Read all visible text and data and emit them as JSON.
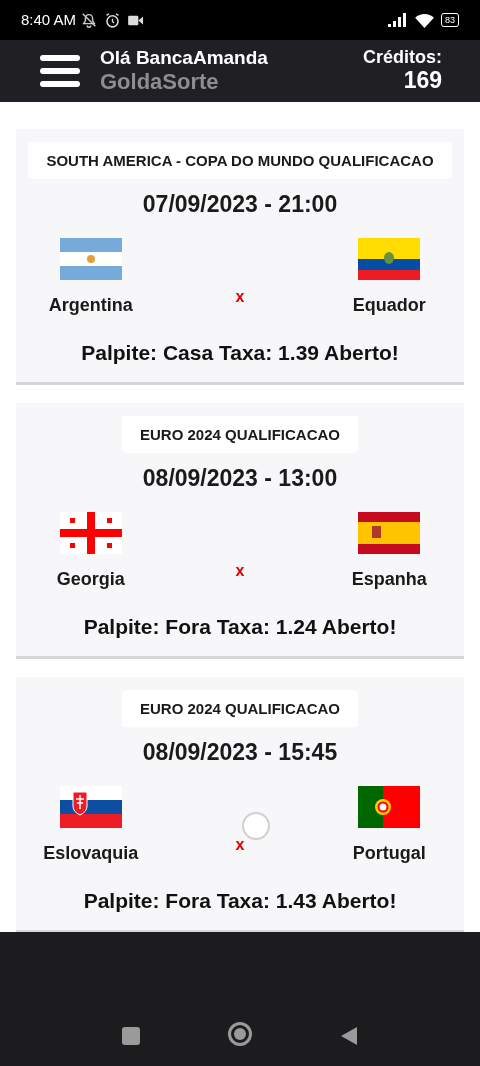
{
  "status_bar": {
    "time": "8:40 AM",
    "battery": "83"
  },
  "app_bar": {
    "greeting": "Olá BancaAmanda",
    "app_name": "GoldaSorte",
    "credits_label": "Créditos:",
    "credits_value": "169"
  },
  "matches": [
    {
      "league": "SOUTH AMERICA - COPA DO MUNDO QUALIFICACAO",
      "datetime": "07/09/2023 - 21:00",
      "home": {
        "name": "Argentina",
        "kind": "ar"
      },
      "separator": "x",
      "away": {
        "name": "Equador",
        "kind": "ec"
      },
      "tip": "Palpite: Casa Taxa: 1.39 Aberto!"
    },
    {
      "league": "EURO 2024 QUALIFICACAO",
      "datetime": "08/09/2023 - 13:00",
      "home": {
        "name": "Georgia",
        "kind": "ge"
      },
      "separator": "x",
      "away": {
        "name": "Espanha",
        "kind": "es"
      },
      "tip": "Palpite: Fora Taxa: 1.24 Aberto!"
    },
    {
      "league": "EURO 2024 QUALIFICACAO",
      "datetime": "08/09/2023 - 15:45",
      "home": {
        "name": "Eslovaquia",
        "kind": "sk"
      },
      "separator": "x",
      "away": {
        "name": "Portugal",
        "kind": "pt"
      },
      "tip": "Palpite: Fora Taxa: 1.43 Aberto!"
    }
  ]
}
